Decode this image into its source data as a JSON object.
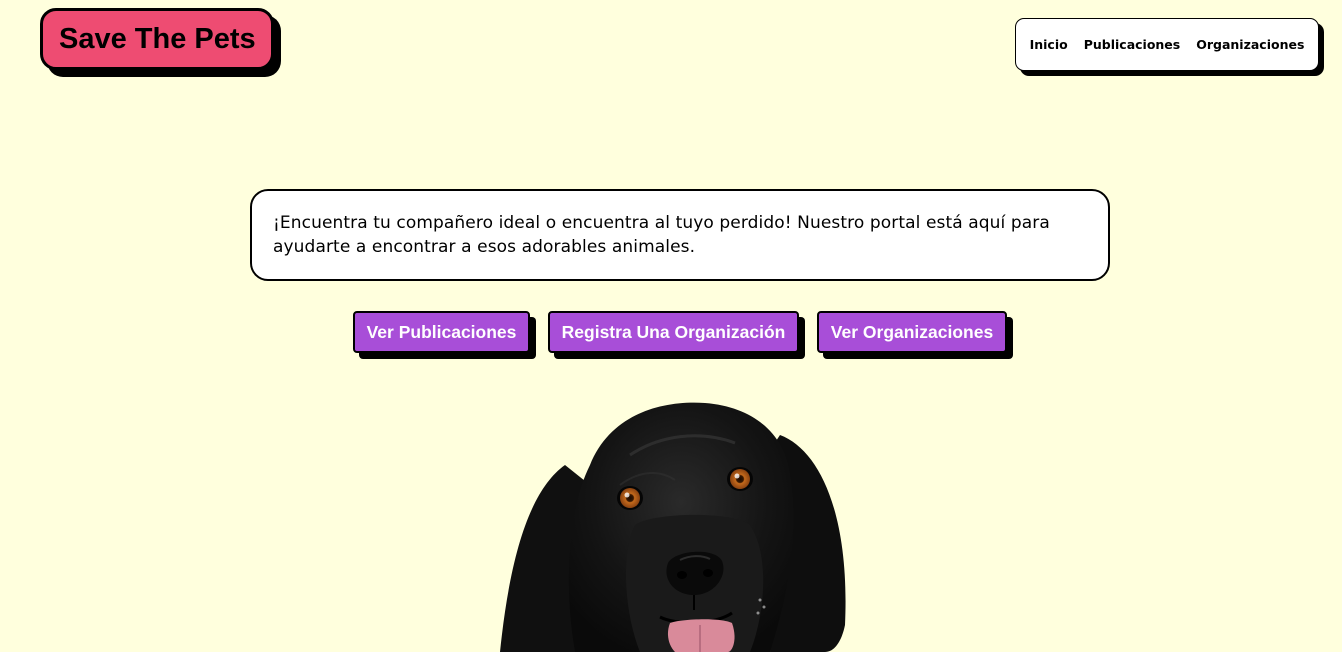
{
  "header": {
    "logo_text": "Save The Pets"
  },
  "nav": {
    "items": [
      {
        "label": "Inicio"
      },
      {
        "label": "Publicaciones"
      },
      {
        "label": "Organizaciones"
      }
    ]
  },
  "hero": {
    "intro_text": "¡Encuentra tu compañero ideal o encuentra al tuyo perdido! Nuestro portal está aquí para ayudarte a encontrar a esos adorables animales."
  },
  "actions": {
    "buttons": [
      {
        "label": "Ver Publicaciones"
      },
      {
        "label": "Registra Una Organización"
      },
      {
        "label": "Ver Organizaciones"
      }
    ]
  },
  "colors": {
    "background": "#ffffdd",
    "logo_bg": "#ee4c72",
    "button_bg": "#a84ed8",
    "text": "#000000"
  },
  "image": {
    "subject": "black-dog-photo"
  }
}
